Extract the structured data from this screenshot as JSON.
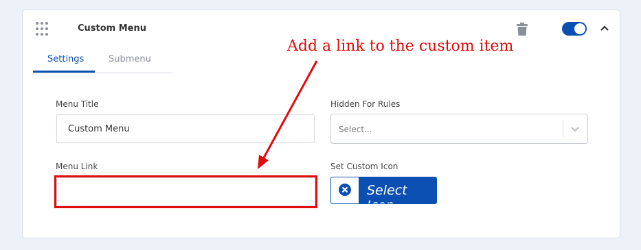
{
  "panel": {
    "title": "Custom Menu",
    "enabled": true
  },
  "tabs": [
    {
      "label": "Settings",
      "active": true
    },
    {
      "label": "Submenu",
      "active": false
    }
  ],
  "form": {
    "menu_title_label": "Menu Title",
    "menu_title_value": "Custom Menu",
    "hidden_rules_label": "Hidden For Rules",
    "hidden_rules_placeholder": "Select...",
    "menu_link_label": "Menu Link",
    "menu_link_value": "",
    "custom_icon_label": "Set Custom Icon",
    "select_icon_label": "Select Icon"
  },
  "annotation": {
    "text": "Add a link to the custom item",
    "color": "#e00b0b"
  },
  "colors": {
    "accent": "#0c4fb3",
    "highlight": "#e00b0b"
  },
  "icons": {
    "drag": "drag-handle-icon",
    "delete": "trash-icon",
    "collapse": "chevron-up-icon",
    "dropdown": "chevron-down-icon",
    "clear": "close-circle-icon"
  }
}
